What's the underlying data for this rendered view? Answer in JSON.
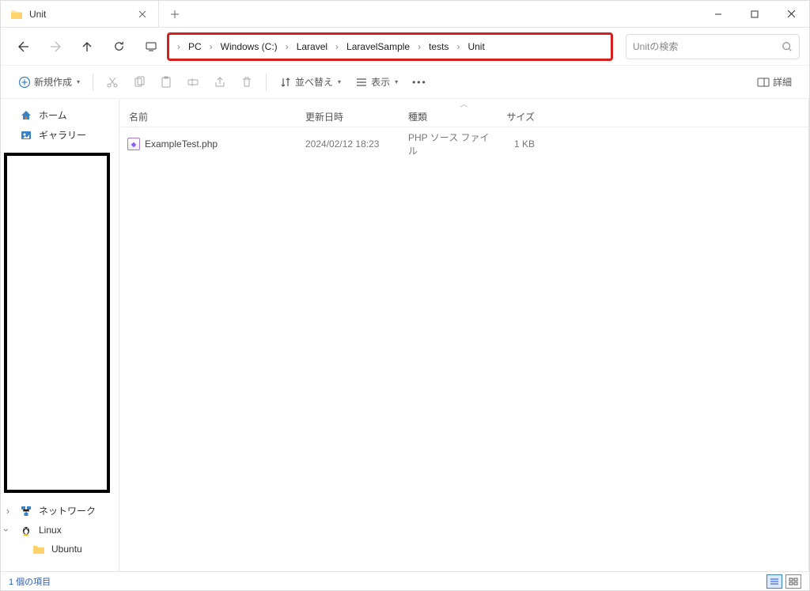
{
  "tab": {
    "title": "Unit"
  },
  "breadcrumb": [
    "PC",
    "Windows (C:)",
    "Laravel",
    "LaravelSample",
    "tests",
    "Unit"
  ],
  "search": {
    "placeholder": "Unitの検索"
  },
  "toolbar": {
    "new_label": "新規作成",
    "sort_label": "並べ替え",
    "view_label": "表示",
    "details_label": "詳細"
  },
  "sidebar": {
    "home": "ホーム",
    "gallery": "ギャラリー",
    "network": "ネットワーク",
    "linux": "Linux",
    "ubuntu": "Ubuntu"
  },
  "columns": {
    "name": "名前",
    "date": "更新日時",
    "type": "種類",
    "size": "サイズ"
  },
  "files": [
    {
      "name": "ExampleTest.php",
      "date": "2024/02/12 18:23",
      "type": "PHP ソース ファイル",
      "size": "1 KB"
    }
  ],
  "status": {
    "count": "1 個の項目"
  }
}
